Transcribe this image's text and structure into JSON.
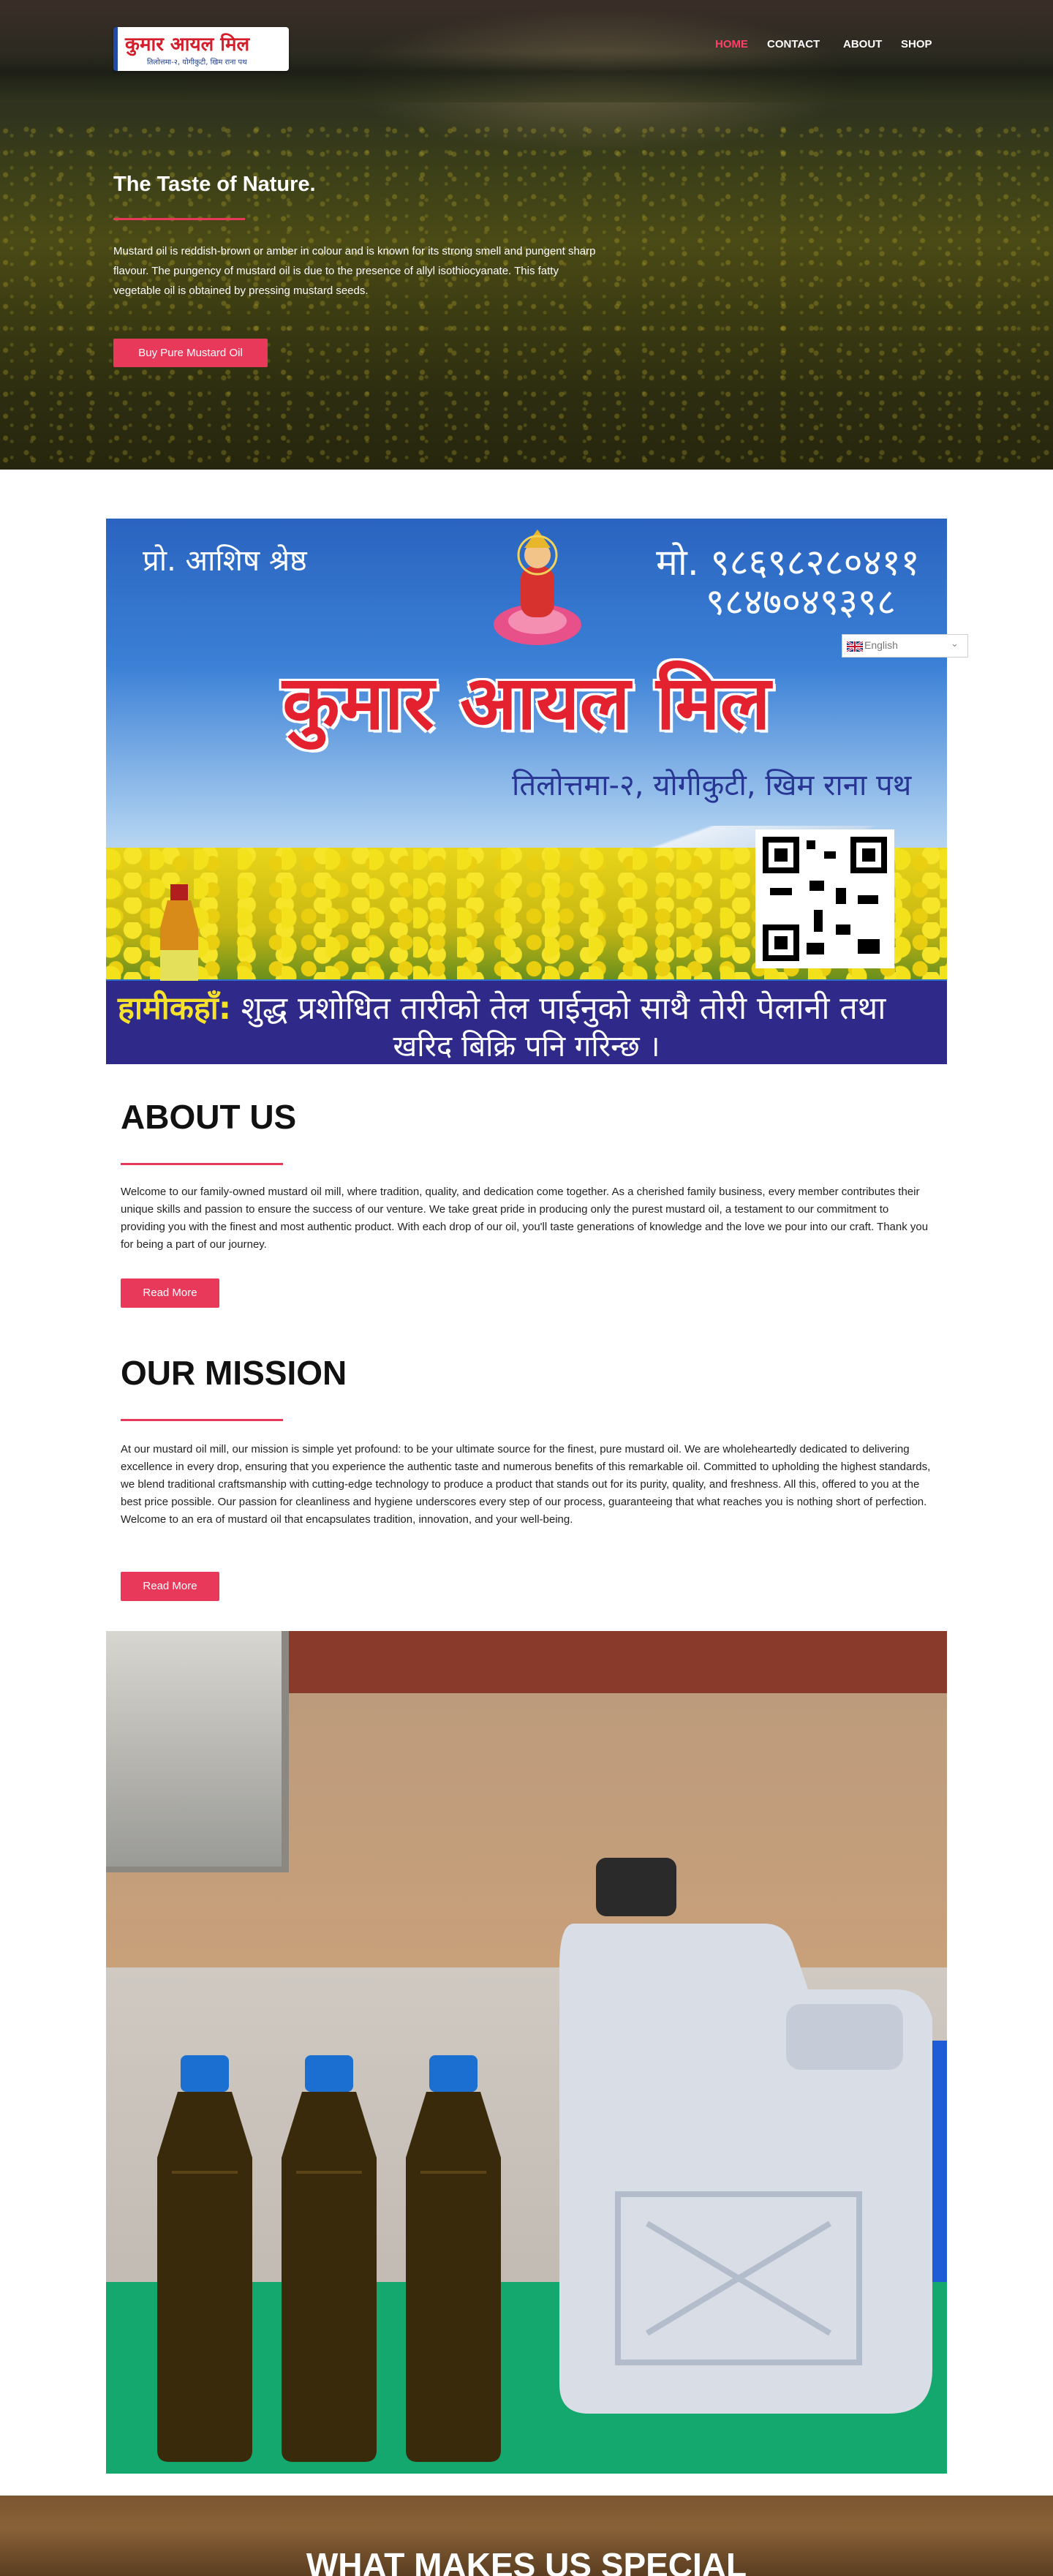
{
  "header": {
    "logo_main": "कुमार आयल मिल",
    "logo_sub": "तिलोत्तमा-२, योगीकुटी, खिम राना पथ",
    "nav": [
      {
        "label": "HOME",
        "active": true
      },
      {
        "label": "CONTACT",
        "active": false
      },
      {
        "label": "ABOUT",
        "active": false
      },
      {
        "label": "SHOP",
        "active": false
      }
    ]
  },
  "hero": {
    "title": "The Taste of Nature.",
    "text": "Mustard oil is reddish-brown or amber in colour and is known for its strong smell and pungent sharp flavour. The pungency of mustard oil is due to the presence of allyl isothiocyanate. This fatty vegetable oil is obtained by pressing mustard seeds.",
    "button": "Buy Pure Mustard Oil"
  },
  "banner": {
    "proprietor": "प्रो. आशिष श्रेष्ठ",
    "phone1": "मो. ९८६९८२८०४११",
    "phone2": "९८४७०४९३९८",
    "title": "कुमार आयल मिल",
    "address": "तिलोत्तमा-२, योगीकुटी, खिम राना पथ",
    "strip_highlight": "हामीकहाँ:",
    "strip_line1": " शुद्ध प्रशोधित तारीको तेल पाईनुको साथै तोरी पेलानी तथा",
    "strip_line2": "खरिद बिक्रि पनि गरिन्छ ।"
  },
  "translate": {
    "label": "English"
  },
  "about": {
    "title": "ABOUT US",
    "text": "Welcome to our family-owned mustard oil mill, where tradition, quality, and dedication come together. As a cherished family business, every member contributes their unique skills and passion to ensure the success of our venture. We take great pride in producing only the purest mustard oil, a testament to our commitment to providing you with the finest and most authentic product. With each drop of our oil, you'll taste generations of knowledge and the love we pour into our craft. Thank you for being a part of our journey.",
    "button": "Read More"
  },
  "mission": {
    "title": "OUR MISSION",
    "text": "At our mustard oil mill, our mission is simple yet profound: to be your ultimate source for the finest, pure mustard oil. We are wholeheartedly dedicated to delivering excellence in every drop, ensuring that you experience the authentic taste and numerous benefits of this remarkable oil. Committed to upholding the highest standards, we blend traditional craftsmanship with cutting-edge technology to produce a product that stands out for its purity, quality, and freshness. All this, offered to you at the best price possible. Our passion for cleanliness and hygiene underscores every step of our process, guaranteeing that what reaches you is nothing short of perfection. Welcome to an era of mustard oil that encapsulates tradition, innovation, and your well-being.",
    "button": "Read More"
  },
  "special": {
    "title": "WHAT MAKES US SPECIAL"
  },
  "colors": {
    "accent": "#e8395a",
    "nav_active": "#ff3f67",
    "banner_blue": "#2f2a8a",
    "banner_red": "#e3212f"
  }
}
